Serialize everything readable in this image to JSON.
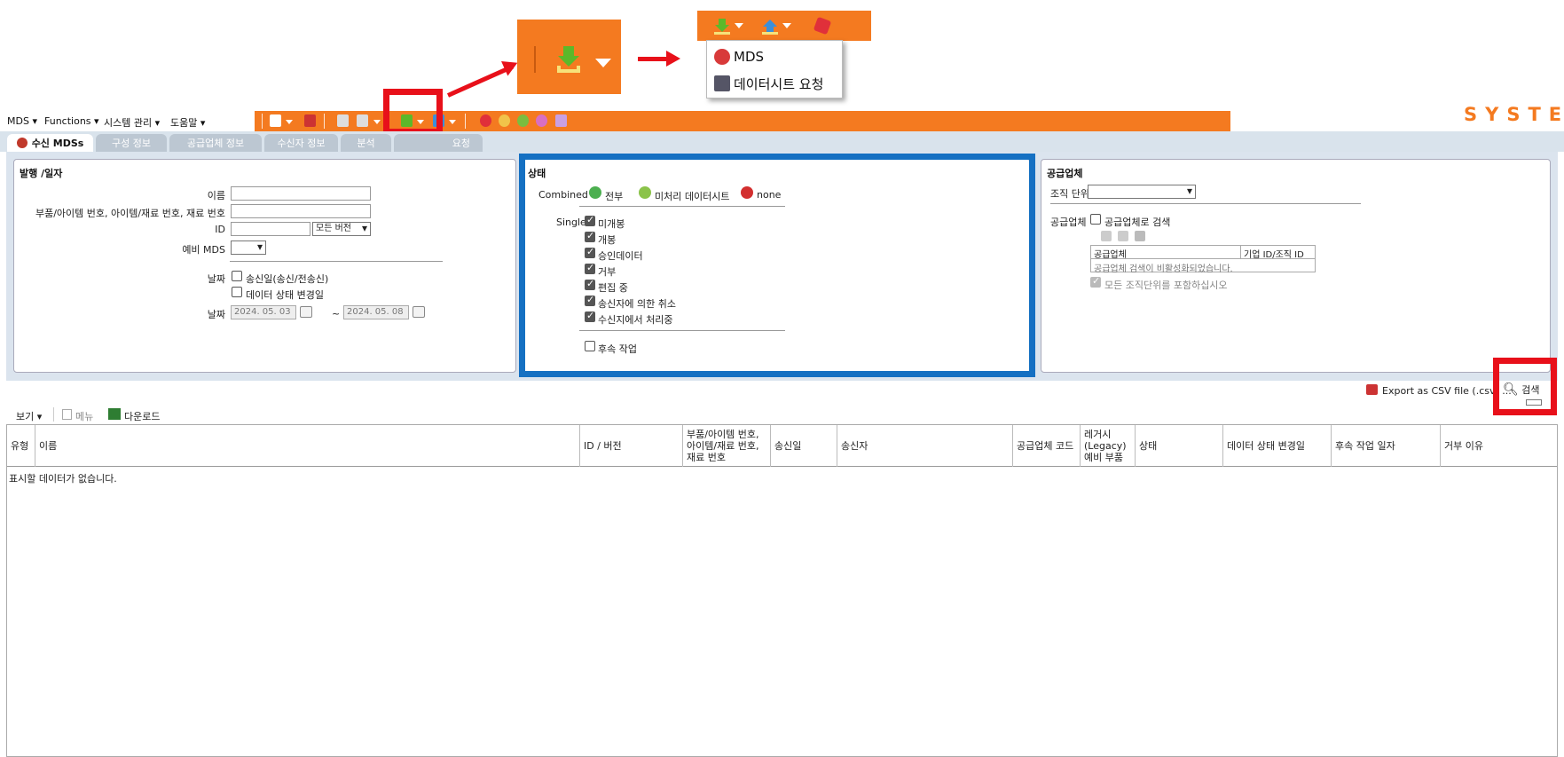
{
  "callout": {
    "menu_items": [
      {
        "label": "MDS"
      },
      {
        "label": "데이터시트 요청"
      }
    ]
  },
  "menubar": {
    "items": [
      "MDS ▾",
      "Functions ▾",
      "시스템 관리 ▾",
      "도움말 ▾"
    ],
    "logo_text": "SYSTEM"
  },
  "tabs": [
    {
      "label": "수신 MDSs",
      "active": true
    },
    {
      "label": "구성 정보"
    },
    {
      "label": "공급업체 정보"
    },
    {
      "label": "수신자 정보"
    },
    {
      "label": "분석"
    },
    {
      "label": "요청"
    }
  ],
  "issue_panel": {
    "title": "발행 /일자",
    "name_label": "이름",
    "part_label": "부품/아이템 번호, 아이템/재료 번호, 재료 번호",
    "id_label": "ID",
    "version_select": "모든 버전",
    "spare_label": "예비 MDS",
    "date_label": "날짜",
    "date_opt1": "송신일(송신/전송신)",
    "date_opt2": "데이터 상태 변경일",
    "date_label2": "날짜",
    "date_from": "2024. 05. 03",
    "date_to": "2024. 05. 08",
    "tilde": "~"
  },
  "status_panel": {
    "title": "상태",
    "combined_label": "Combined",
    "combined_all": "전부",
    "combined_unprocessed": "미처리 데이터시트",
    "combined_none": "none",
    "single_label": "Single",
    "single_items": [
      "미개봉",
      "개봉",
      "승인데이터",
      "거부",
      "편집 중",
      "송신자에 의한 취소",
      "수신지에서 처리중"
    ],
    "followup": "후속 작업"
  },
  "supplier_panel": {
    "title": "공급업체",
    "org_label": "조직 단위",
    "supplier_label": "공급업체",
    "search_by_supplier": "공급업체로 검색",
    "col_supplier": "공급업체",
    "col_company_id": "기업 ID/조직 ID",
    "disabled_msg": "공급업체 검색이 비활성화되었습니다.",
    "include_all": "모든 조직단위를 포함하십시오"
  },
  "actions": {
    "export_csv": "Export as CSV file (.csv) ...",
    "search": "검색"
  },
  "grid_toolbar": {
    "view": "보기 ▾",
    "menu": "메뉴",
    "download": "다운로드"
  },
  "grid": {
    "columns": [
      "유형",
      "이름",
      "ID / 버전",
      "부품/아이템 번호, 아이템/재료 번호, 재료 번호",
      "송신일",
      "송신자",
      "공급업체 코드",
      "레거시 (Legacy) 예비 부품",
      "상태",
      "데이터 상태 변경일",
      "후속 작업 일자",
      "거부 이유"
    ],
    "empty_message": "표시할 데이터가 없습니다."
  },
  "colors": {
    "brand_orange": "#f47a20",
    "highlight_red": "#e8101a",
    "highlight_blue": "#1570c2"
  }
}
